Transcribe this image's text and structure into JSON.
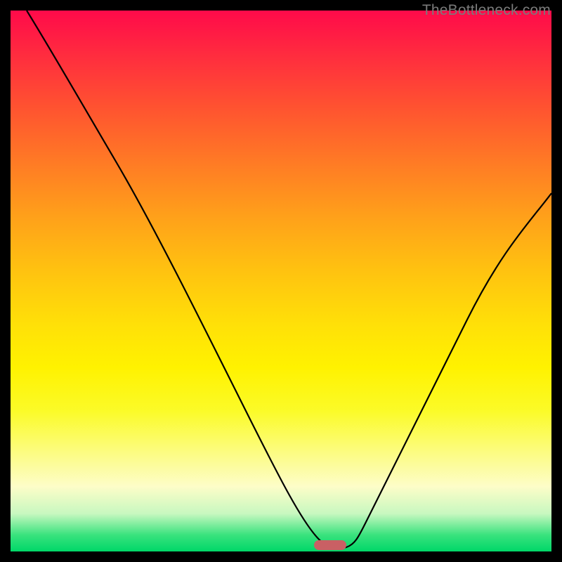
{
  "watermark": "TheBottleneck.com",
  "chart_data": {
    "type": "line",
    "title": "",
    "xlabel": "",
    "ylabel": "",
    "x": [
      3,
      6,
      10,
      14,
      18,
      22,
      26,
      30,
      34,
      38,
      42,
      46,
      50,
      54,
      56.5,
      58,
      60,
      62,
      63,
      66,
      70,
      74,
      78,
      82,
      86,
      90,
      94,
      98,
      100
    ],
    "values": [
      100,
      93,
      84,
      76,
      68,
      62,
      57,
      51,
      45,
      39,
      32,
      24,
      16,
      8,
      2,
      0,
      0,
      0.5,
      2,
      9,
      18,
      26,
      33,
      40,
      47,
      53,
      58,
      63,
      66
    ],
    "xlim": [
      0,
      100
    ],
    "ylim": [
      0,
      100
    ],
    "marker": {
      "x": 60,
      "y": 0
    },
    "colors": {
      "line": "#000000",
      "marker": "#c96064"
    }
  }
}
